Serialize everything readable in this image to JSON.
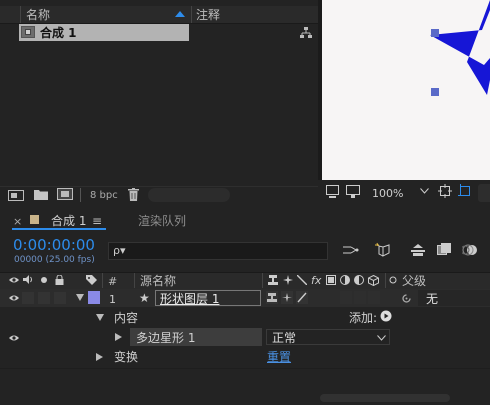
{
  "project": {
    "col_name": "名称",
    "col_comment": "注释",
    "item_name": "合成 1",
    "bpc": "8 bpc"
  },
  "viewer": {
    "zoom": "100%"
  },
  "timeline": {
    "tab_label": "合成 1",
    "tab_menu": "≡",
    "render_tab": "渲染队列",
    "timecode": "0:00:00:00",
    "frame_info": "00000 (25.00 fps)",
    "search_prefix": "ρ▾",
    "headers": {
      "hash": "#",
      "source_name": "源名称",
      "parent": "父级",
      "fx": "fx"
    },
    "layer": {
      "index": "1",
      "name": "形状图层 1",
      "parent_value": "无"
    },
    "contents_label": "内容",
    "add_label": "添加:",
    "shape_group": "多边星形 1",
    "blend_mode": "正常",
    "transform_label": "变换",
    "reset_label": "重置"
  },
  "colors": {
    "accent_blue": "#2d8ceb",
    "star_blue": "#1616d6",
    "label_purple": "#8a8ae6",
    "canvas_bg": "#f7f5f5"
  }
}
